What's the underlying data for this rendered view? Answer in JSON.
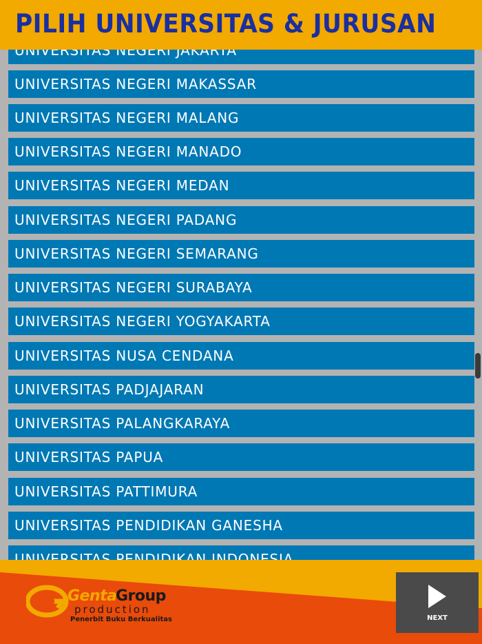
{
  "header": {
    "title": "PILIH UNIVERSITAS & JURUSAN"
  },
  "list": {
    "items": [
      "UNIVERSITAS NEGERI JAKARTA",
      "UNIVERSITAS NEGERI MAKASSAR",
      "UNIVERSITAS NEGERI MALANG",
      "UNIVERSITAS NEGERI MANADO",
      "UNIVERSITAS NEGERI MEDAN",
      "UNIVERSITAS NEGERI PADANG",
      "UNIVERSITAS NEGERI SEMARANG",
      "UNIVERSITAS NEGERI SURABAYA",
      "UNIVERSITAS NEGERI YOGYAKARTA",
      "UNIVERSITAS NUSA CENDANA",
      "UNIVERSITAS PADJAJARAN",
      "UNIVERSITAS PALANGKARAYA",
      "UNIVERSITAS PAPUA",
      "UNIVERSITAS PATTIMURA",
      "UNIVERSITAS PENDIDIKAN GANESHA",
      "UNIVERSITAS PENDIDIKAN INDONESIA"
    ]
  },
  "footer": {
    "logo": {
      "brand_primary": "Genta",
      "brand_secondary": "Group",
      "production": "production",
      "tagline": "Penerbit Buku Berkualitas"
    },
    "next_label": "NEXT"
  },
  "colors": {
    "header_bg": "#f2a900",
    "title": "#1a2fa0",
    "item_bg": "#0078b4",
    "list_bg": "#b3b3b3",
    "footer_bg": "#e94b0a",
    "next_bg": "#4a4a4a"
  },
  "icons": {
    "logo_mark": "genta-g-logo-icon",
    "next": "play-triangle-icon"
  }
}
